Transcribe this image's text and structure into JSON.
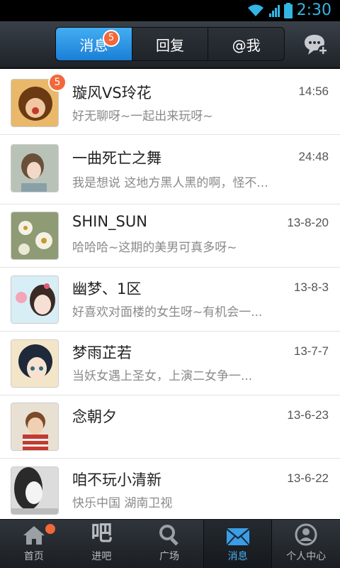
{
  "status_bar": {
    "time": "2:30"
  },
  "header": {
    "tabs": [
      {
        "label": "消息",
        "badge": "5",
        "active": true
      },
      {
        "label": "回复",
        "active": false
      },
      {
        "label": "@我",
        "active": false
      }
    ]
  },
  "conversations": [
    {
      "name": "璇风VS玲花",
      "time": "14:56",
      "preview": "好无聊呀~一起出来玩呀~",
      "badge": "5"
    },
    {
      "name": "一曲死亡之舞",
      "time": "24:48",
      "preview": "我是想说 这地方黑人黑的啊，怪不..."
    },
    {
      "name": "SHIN_SUN",
      "time": "13-8-20",
      "preview": "哈哈哈~这期的美男可真多呀~"
    },
    {
      "name": "幽梦、1区",
      "time": "13-8-3",
      "preview": "好喜欢对面楼的女生呀~有机会一..."
    },
    {
      "name": "梦雨芷若",
      "time": "13-7-7",
      "preview": "当妖女遇上圣女，上演二女争一..."
    },
    {
      "name": "念朝夕",
      "time": "13-6-23",
      "preview": ""
    },
    {
      "name": "咱不玩小清新",
      "time": "13-6-22",
      "preview": "快乐中国 湖南卫视"
    }
  ],
  "bottom_nav": [
    {
      "label": "首页",
      "icon": "home-icon",
      "dot": true
    },
    {
      "label": "进吧",
      "icon": "ba-glyph-icon",
      "glyph": "吧"
    },
    {
      "label": "广场",
      "icon": "search-icon"
    },
    {
      "label": "消息",
      "icon": "envelope-icon",
      "active": true
    },
    {
      "label": "个人中心",
      "icon": "user-icon"
    }
  ],
  "colors": {
    "accent": "#1a8fe0",
    "badge": "#f2683a",
    "active_label": "#4ab0f0"
  }
}
